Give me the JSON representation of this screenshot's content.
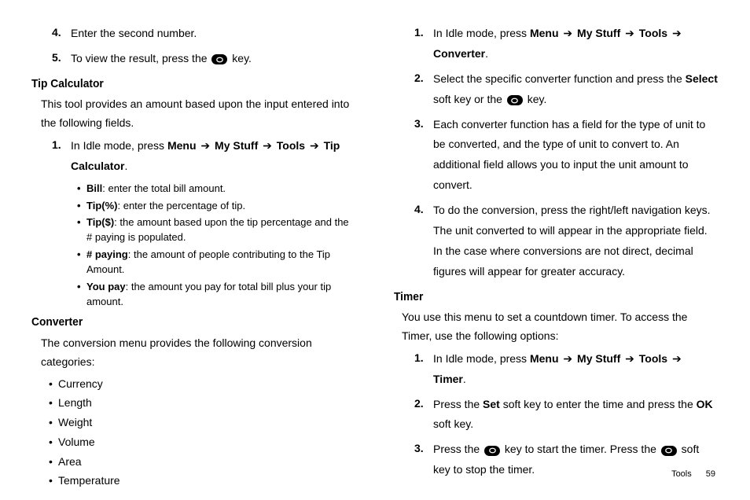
{
  "left": {
    "step4": {
      "num": "4.",
      "text": "Enter the second number."
    },
    "step5": {
      "num": "5.",
      "pre": "To view the result, press the ",
      "post": " key."
    },
    "tip_heading": "Tip Calculator",
    "tip_intro": "This tool provides an amount based upon the input entered into the following fields.",
    "tip_step1": {
      "num": "1.",
      "pre": "In Idle mode, press ",
      "path_menu": "Menu",
      "path_stuff": "My Stuff",
      "path_tools": "Tools",
      "path_last1": "Tip",
      "path_last2": "Calculator",
      "period": "."
    },
    "bullets": {
      "b1": {
        "label": "Bill",
        "text": ": enter the total bill amount."
      },
      "b2": {
        "label": "Tip(%)",
        "text": ": enter the percentage of tip."
      },
      "b3": {
        "label": "Tip($)",
        "text": ": the amount based upon the tip percentage and the # paying is populated."
      },
      "b4": {
        "label": "# paying",
        "text": ": the amount of people contributing to the Tip Amount."
      },
      "b5": {
        "label": "You pay",
        "text": ": the amount you pay for total bill plus your tip amount."
      }
    },
    "conv_heading": "Converter",
    "conv_intro": "The conversion menu provides the following conversion categories:",
    "conv_items": {
      "c1": "Currency",
      "c2": "Length",
      "c3": "Weight",
      "c4": "Volume",
      "c5": "Area",
      "c6": "Temperature"
    }
  },
  "right": {
    "s1": {
      "num": "1.",
      "pre": "In Idle mode, press ",
      "p_menu": "Menu",
      "p_stuff": "My Stuff",
      "p_tools": "Tools",
      "p_last": "Converter",
      "period": "."
    },
    "s2": {
      "num": "2.",
      "pre": "Select the specific converter function and press the ",
      "select": "Select",
      "mid": " soft key or the ",
      "post": " key."
    },
    "s3": {
      "num": "3.",
      "text": "Each converter function has a field for the type of unit to be converted, and the type of unit to convert to. An additional field allows you to input the unit amount to convert."
    },
    "s4": {
      "num": "4.",
      "text": "To do the conversion, press the right/left navigation keys. The unit converted to will appear in the appropriate field. In the case where conversions are not direct, decimal figures will appear for greater accuracy."
    },
    "timer_heading": "Timer",
    "timer_intro": "You use this menu to set a countdown timer. To access the Timer, use the following options:",
    "t1": {
      "num": "1.",
      "pre": "In Idle mode, press ",
      "p_menu": "Menu",
      "p_stuff": "My Stuff",
      "p_tools": "Tools",
      "p_last": "Timer",
      "period": "."
    },
    "t2": {
      "num": "2.",
      "pre": "Press the ",
      "set": "Set",
      "mid": " soft key to enter the time and press the ",
      "ok": "OK",
      "post": " soft key."
    },
    "t3": {
      "num": "3.",
      "pre": "Press the ",
      "mid": " key to start the timer. Press the ",
      "post": " soft key to stop the timer."
    }
  },
  "footer": {
    "label": "Tools",
    "page": "59"
  }
}
